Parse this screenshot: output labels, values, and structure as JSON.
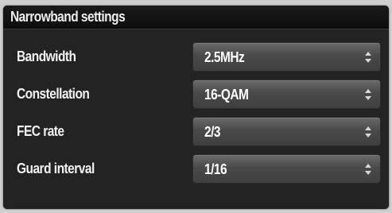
{
  "panel": {
    "title": "Narrowband settings"
  },
  "settings": [
    {
      "label": "Bandwidth",
      "value": "2.5MHz"
    },
    {
      "label": "Constellation",
      "value": "16-QAM"
    },
    {
      "label": "FEC rate",
      "value": "2/3"
    },
    {
      "label": "Guard interval",
      "value": "1/16"
    }
  ],
  "icons": {
    "select_arrows": "up-down-arrows-icon"
  },
  "colors": {
    "panel_bg": "#232323",
    "header_bg": "#0d0d0d",
    "text": "#f2f2f2",
    "select_bg": "#4a4a4a"
  }
}
